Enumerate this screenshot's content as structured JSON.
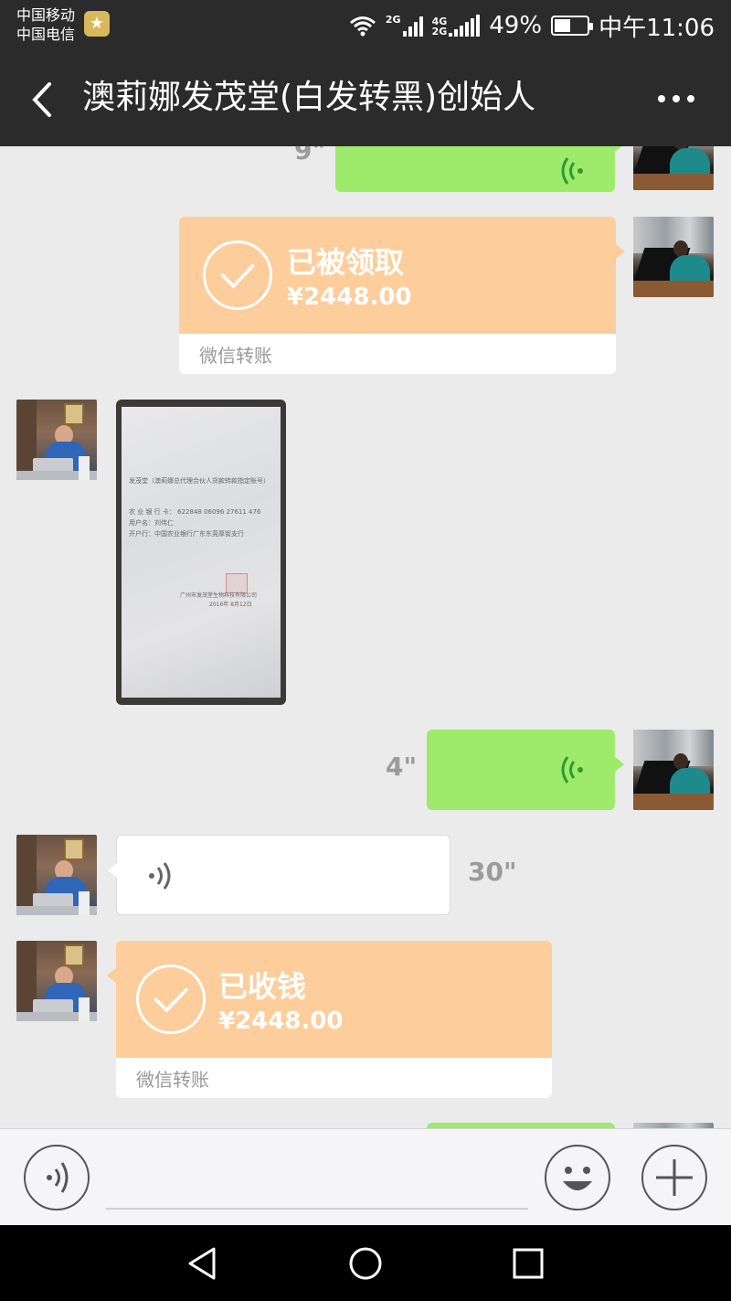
{
  "status_bar": {
    "carrier_1": "中国移动",
    "carrier_2": "中国电信",
    "network_1": "2G",
    "network_2_top": "4G",
    "network_2_bottom": "2G",
    "battery_percent": "49%",
    "battery_level": 0.49,
    "time": "中午11:06"
  },
  "header": {
    "title": "澳莉娜发茂堂(白发转黑)创始人"
  },
  "messages": [
    {
      "type": "voice",
      "side": "right",
      "duration": "9\"",
      "partial": true
    },
    {
      "type": "transfer",
      "side": "right",
      "status": "已被领取",
      "amount": "¥2448.00",
      "label": "微信转账"
    },
    {
      "type": "image",
      "side": "left",
      "document_lines": [
        "发茂堂（澳莉娜总代理合伙人货款转款指定账号）",
        "农 业 银 行 卡：  622848  06096  27611  476",
        "用户名：刘伟仁",
        "开户行：中国农业银行广东东莞厚街支行",
        "广州市发茂堂生物科技有限公司",
        "2016年 8月12日"
      ]
    },
    {
      "type": "voice",
      "side": "right",
      "duration": "4\""
    },
    {
      "type": "voice",
      "side": "left",
      "duration": "30\""
    },
    {
      "type": "transfer",
      "side": "left",
      "status": "已收钱",
      "amount": "¥2448.00",
      "label": "微信转账"
    }
  ],
  "colors": {
    "header_bg": "#2b2b2b",
    "chat_bg": "#ebebeb",
    "green_bubble": "#9eea6a",
    "transfer_orange": "#fdce9c"
  },
  "icons": {
    "back": "chevron-left-icon",
    "more": "more-dots-icon",
    "voice_mode": "voice-icon",
    "emoji": "emoji-icon",
    "plus": "plus-icon",
    "nav_back": "triangle-back-icon",
    "nav_home": "circle-home-icon",
    "nav_recent": "square-recent-icon"
  }
}
